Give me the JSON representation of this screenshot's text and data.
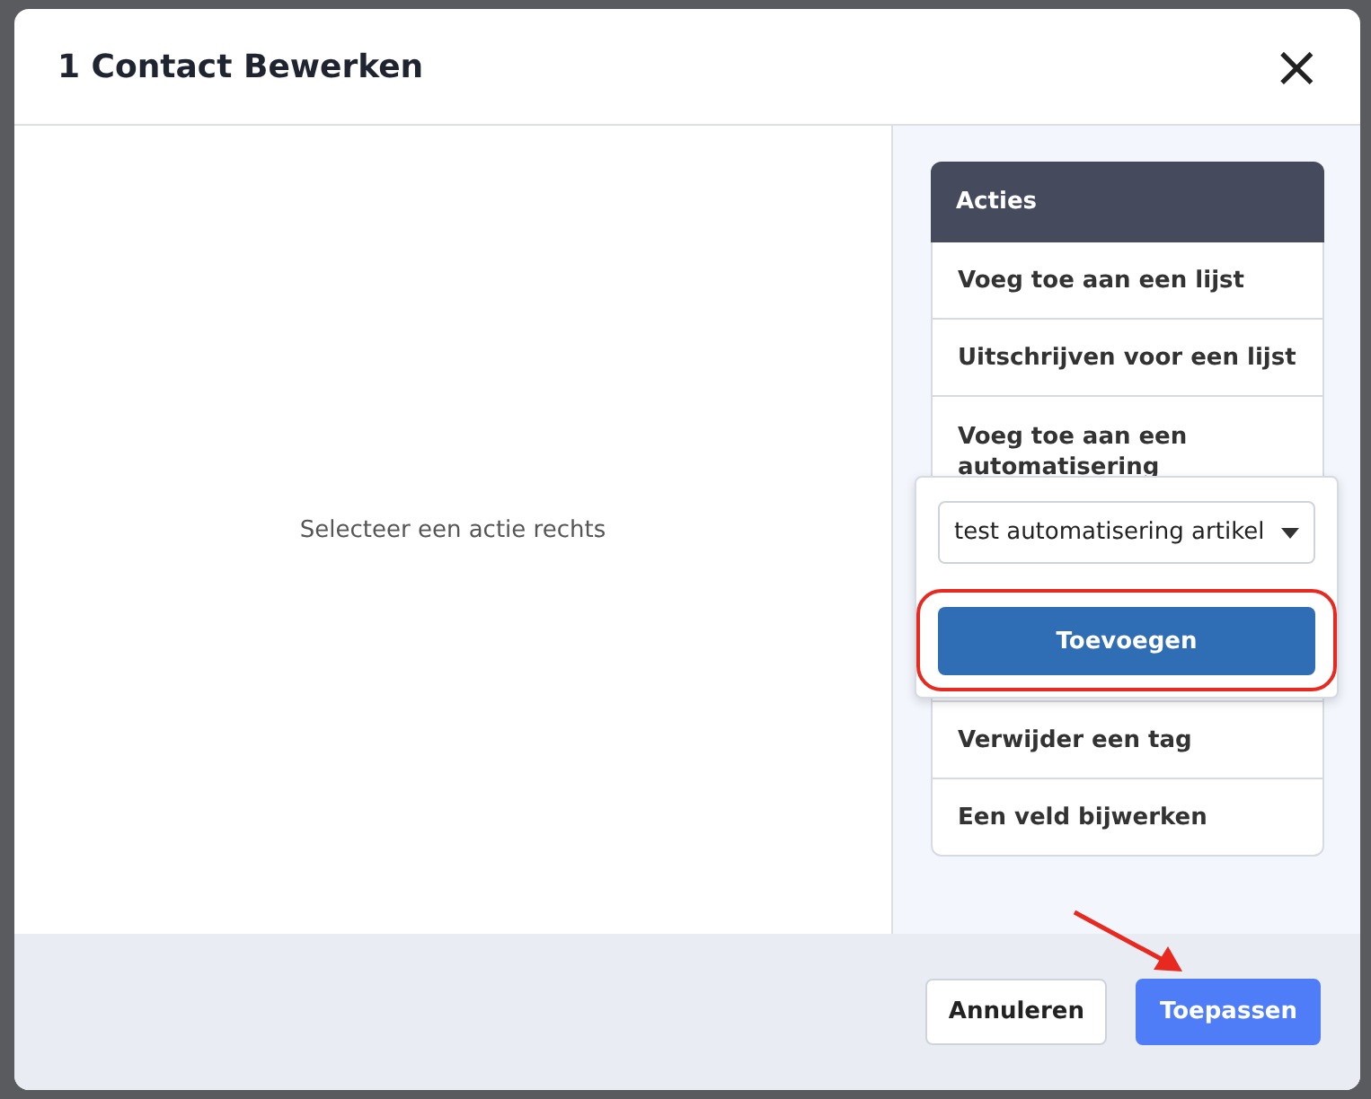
{
  "dialog": {
    "title": "1 Contact Bewerken",
    "close": "×"
  },
  "left_panel": {
    "message": "Selecteer een actie rechts"
  },
  "actions": {
    "title": "Acties",
    "items": [
      {
        "label": "Voeg toe aan een lijst",
        "kind": "item"
      },
      {
        "label": "Uitschrijven voor een lijst",
        "kind": "item"
      },
      {
        "label": "Voeg toe aan een automatisering",
        "kind": "expanded"
      },
      {
        "label": "Verwijder een tag",
        "kind": "item"
      },
      {
        "label": "Een veld bijwerken",
        "kind": "item"
      }
    ]
  },
  "popup": {
    "select_value": "test automatisering artikel",
    "button": "Toevoegen"
  },
  "footer": {
    "buttons": [
      {
        "label": "Annuleren",
        "kind": "secondary"
      },
      {
        "label": "Toepassen",
        "kind": "primary"
      }
    ]
  }
}
